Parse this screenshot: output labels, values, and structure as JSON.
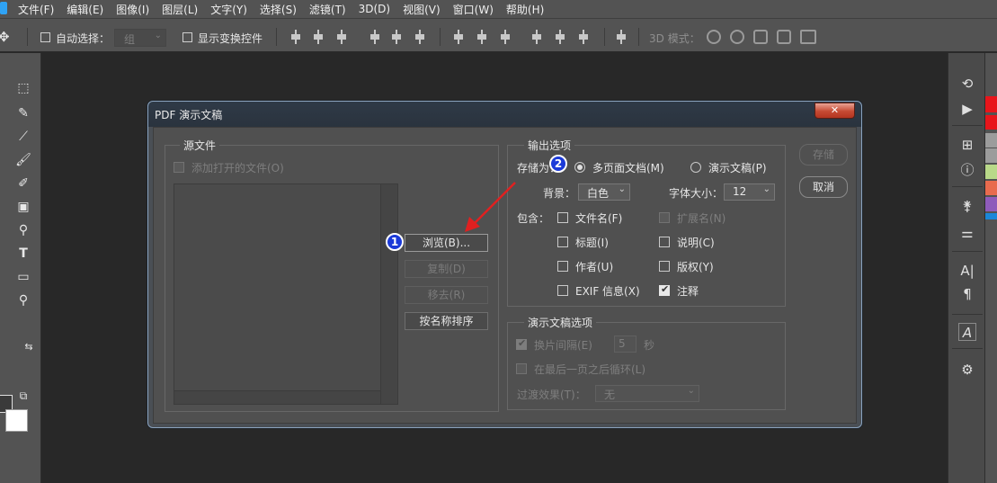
{
  "menu": [
    "文件(F)",
    "编辑(E)",
    "图像(I)",
    "图层(L)",
    "文字(Y)",
    "选择(S)",
    "滤镜(T)",
    "3D(D)",
    "视图(V)",
    "窗口(W)",
    "帮助(H)"
  ],
  "options_bar": {
    "auto_select_label": "自动选择：",
    "auto_select_value": "组",
    "show_transform_label": "显示变换控件",
    "mode_3d_label": "3D 模式："
  },
  "dialog": {
    "title": "PDF 演示文稿",
    "close_label": "✕",
    "source": {
      "title": "源文件",
      "add_open_files": "添加打开的文件(O)"
    },
    "buttons": {
      "browse": "浏览(B)...",
      "duplicate": "复制(D)",
      "remove": "移去(R)",
      "sort": "按名称排序",
      "save": "存储",
      "cancel": "取消"
    },
    "output": {
      "title": "输出选项",
      "save_as_label": "存储为：",
      "multipage": "多页面文档(M)",
      "presentation": "演示文稿(P)",
      "background_label": "背景：",
      "background_value": "白色",
      "font_size_label": "字体大小：",
      "font_size_value": "12",
      "include_label": "包含：",
      "filename": "文件名(F)",
      "extension": "扩展名(N)",
      "title_opt": "标题(I)",
      "description": "说明(C)",
      "author": "作者(U)",
      "copyright": "版权(Y)",
      "exif": "EXIF 信息(X)",
      "notes": "注释"
    },
    "presentation_opts": {
      "title": "演示文稿选项",
      "advance_every": "换片间隔(E)",
      "advance_value": "5",
      "seconds": "秒",
      "loop": "在最后一页之后循环(L)",
      "transition_label": "过渡效果(T)：",
      "transition_value": "无"
    }
  },
  "annotations": {
    "step1": "1",
    "step2": "2",
    "arrow_color": "#e02020"
  },
  "colors": {
    "swatch_red": "#e8151b",
    "swatch_gray": "#9c9c9c",
    "swatch_green": "#b9d989",
    "swatch_orange": "#e86b4e",
    "swatch_purple": "#8f5bbb",
    "swatch_blue": "#1a87d9"
  }
}
